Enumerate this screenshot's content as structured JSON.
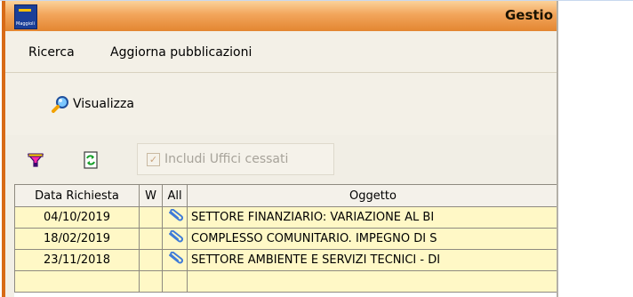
{
  "window": {
    "title": "Gestio"
  },
  "menu": {
    "items": [
      "Ricerca",
      "Aggiorna pubblicazioni"
    ]
  },
  "toolbar": {
    "visualizza_label": "Visualizza",
    "checkbox_label": "Includi Uffici cessati",
    "checkbox_checked": true,
    "checkbox_enabled": false
  },
  "grid": {
    "columns": [
      "Data Richiesta",
      "W",
      "All",
      "Oggetto"
    ],
    "rows": [
      {
        "date": "04/10/2019",
        "w": "",
        "oggetto": "SETTORE FINANZIARIO: VARIAZIONE AL BI"
      },
      {
        "date": "18/02/2019",
        "w": "",
        "oggetto": "COMPLESSO COMUNITARIO. IMPEGNO DI S"
      },
      {
        "date": "23/11/2018",
        "w": "",
        "oggetto": "SETTORE AMBIENTE E SERVIZI TECNICI - DI"
      }
    ]
  },
  "icons": {
    "app": "app-logo-icon",
    "visualizza": "magnifier-icon",
    "filter": "funnel-icon",
    "refresh": "refresh-icon",
    "attachment": "paperclip-icon"
  },
  "colors": {
    "titlebar": "#e38631",
    "row_highlight": "#fff8c6",
    "border_accent": "#d86b17"
  }
}
